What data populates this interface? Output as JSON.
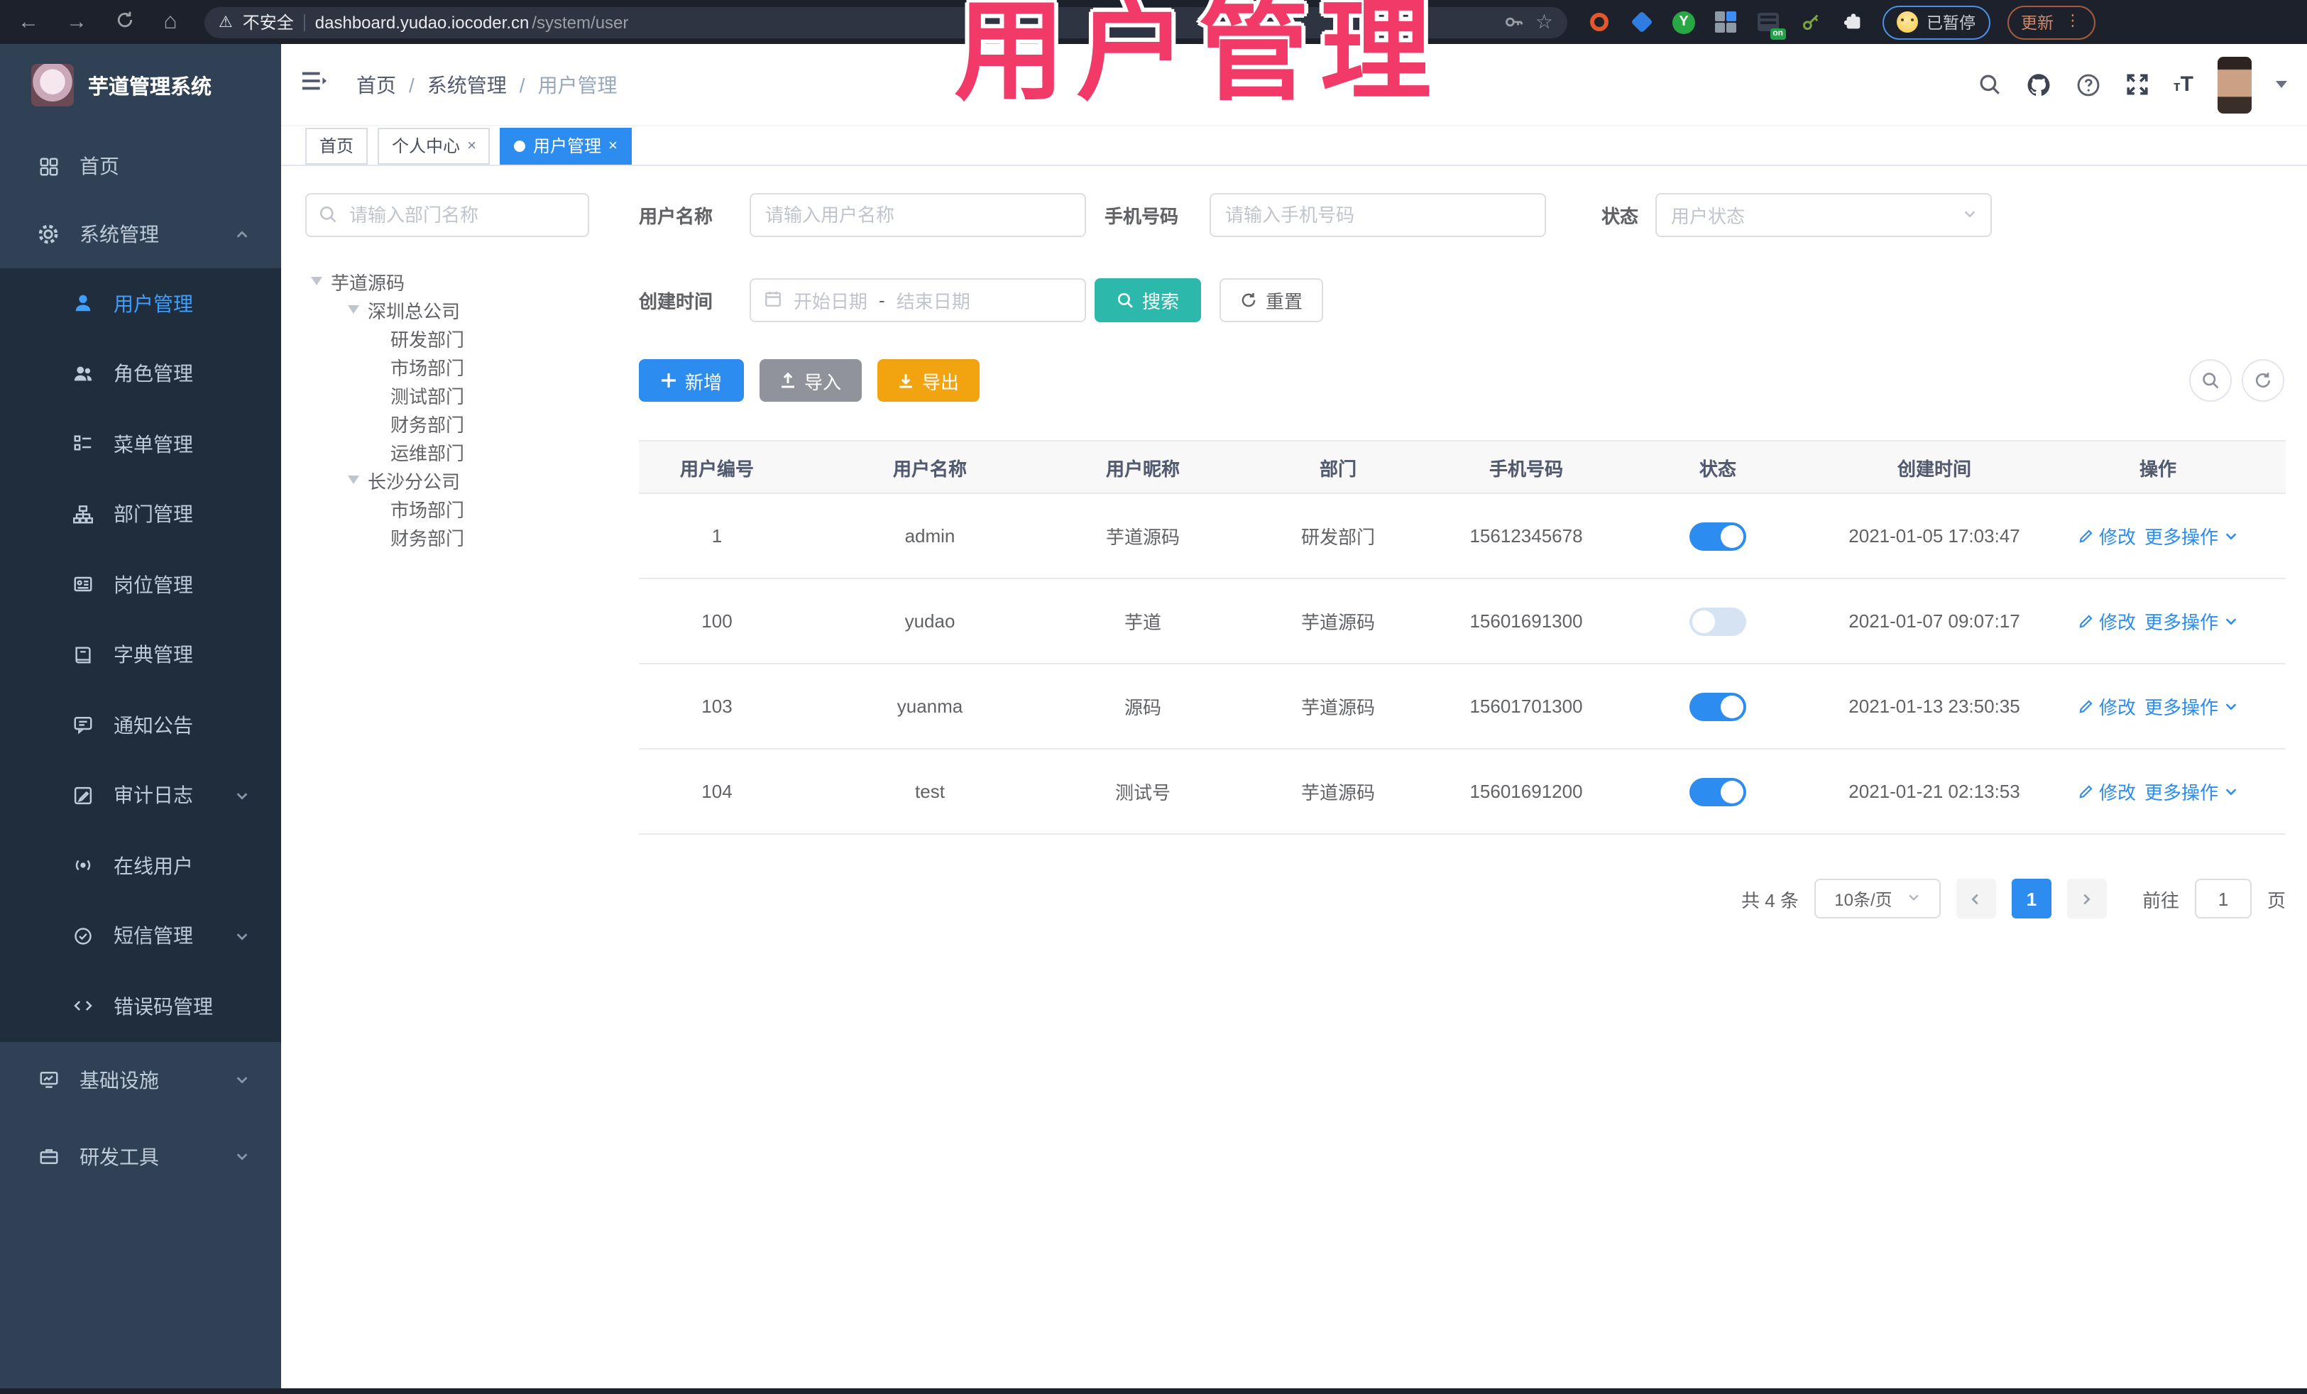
{
  "chrome": {
    "security": "不安全",
    "url_host": "dashboard.yudao.iocoder.cn",
    "url_path": "/system/user",
    "profile_status": "已暂停",
    "update_label": "更新",
    "ext_on_label": "on",
    "ext_y_label": "Y"
  },
  "overlay_title": "用户管理",
  "sidebar": {
    "app_title": "芋道管理系统",
    "top": [
      "首页",
      "系统管理"
    ],
    "submenu": [
      "用户管理",
      "角色管理",
      "菜单管理",
      "部门管理",
      "岗位管理",
      "字典管理",
      "通知公告",
      "审计日志",
      "在线用户",
      "短信管理",
      "错误码管理"
    ],
    "bottom": [
      "基础设施",
      "研发工具"
    ]
  },
  "breadcrumb": [
    "首页",
    "系统管理",
    "用户管理"
  ],
  "breadcrumb_sep": "/",
  "tabs": [
    "首页",
    "个人中心",
    "用户管理"
  ],
  "tab_close": "×",
  "tree": {
    "placeholder": "请输入部门名称",
    "nodes": [
      "芋道源码",
      "深圳总公司",
      "研发部门",
      "市场部门",
      "测试部门",
      "财务部门",
      "运维部门",
      "长沙分公司",
      "市场部门",
      "财务部门"
    ]
  },
  "filters": {
    "username_label": "用户名称",
    "username_placeholder": "请输入用户名称",
    "mobile_label": "手机号码",
    "mobile_placeholder": "请输入手机号码",
    "status_label": "状态",
    "status_placeholder": "用户状态",
    "date_label": "创建时间",
    "date_start": "开始日期",
    "date_sep": "-",
    "date_end": "结束日期",
    "search": "搜索",
    "reset": "重置"
  },
  "toolbar": {
    "add": "新增",
    "import": "导入",
    "export": "导出"
  },
  "table": {
    "columns": [
      "用户编号",
      "用户名称",
      "用户昵称",
      "部门",
      "手机号码",
      "状态",
      "创建时间",
      "操作"
    ],
    "edit_label": "修改",
    "more_label": "更多操作",
    "rows": [
      {
        "id": "1",
        "username": "admin",
        "nickname": "芋道源码",
        "dept": "研发部门",
        "mobile": "15612345678",
        "status": "on",
        "created": "2021-01-05 17:03:47"
      },
      {
        "id": "100",
        "username": "yudao",
        "nickname": "芋道",
        "dept": "芋道源码",
        "mobile": "15601691300",
        "status": "off",
        "created": "2021-01-07 09:07:17"
      },
      {
        "id": "103",
        "username": "yuanma",
        "nickname": "源码",
        "dept": "芋道源码",
        "mobile": "15601701300",
        "status": "on",
        "created": "2021-01-13 23:50:35"
      },
      {
        "id": "104",
        "username": "test",
        "nickname": "测试号",
        "dept": "芋道源码",
        "mobile": "15601691200",
        "status": "on",
        "created": "2021-01-21 02:13:53"
      }
    ]
  },
  "pagination": {
    "total": "共 4 条",
    "size": "10条/页",
    "page": "1",
    "goto": "前往",
    "unit": "页",
    "goto_value": "1"
  }
}
